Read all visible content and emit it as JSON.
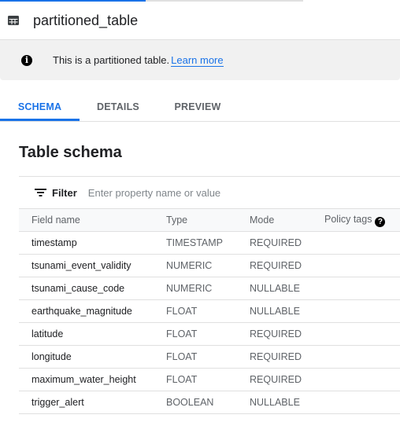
{
  "header": {
    "title": "partitioned_table"
  },
  "banner": {
    "message": "This is a partitioned table.",
    "link": "Learn more"
  },
  "tabs": [
    {
      "label": "SCHEMA",
      "active": true
    },
    {
      "label": "DETAILS"
    },
    {
      "label": "PREVIEW"
    }
  ],
  "schema": {
    "heading": "Table schema",
    "filter_label": "Filter",
    "filter_placeholder": "Enter property name or value",
    "columns": [
      "Field name",
      "Type",
      "Mode",
      "Policy tags"
    ],
    "rows": [
      {
        "name": "timestamp",
        "type": "TIMESTAMP",
        "mode": "REQUIRED"
      },
      {
        "name": "tsunami_event_validity",
        "type": "NUMERIC",
        "mode": "REQUIRED"
      },
      {
        "name": "tsunami_cause_code",
        "type": "NUMERIC",
        "mode": "NULLABLE"
      },
      {
        "name": "earthquake_magnitude",
        "type": "FLOAT",
        "mode": "NULLABLE"
      },
      {
        "name": "latitude",
        "type": "FLOAT",
        "mode": "REQUIRED"
      },
      {
        "name": "longitude",
        "type": "FLOAT",
        "mode": "REQUIRED"
      },
      {
        "name": "maximum_water_height",
        "type": "FLOAT",
        "mode": "REQUIRED"
      },
      {
        "name": "trigger_alert",
        "type": "BOOLEAN",
        "mode": "NULLABLE"
      }
    ]
  },
  "colors": {
    "accent": "#1a73e8",
    "banner_bg": "#f1f1f1"
  }
}
